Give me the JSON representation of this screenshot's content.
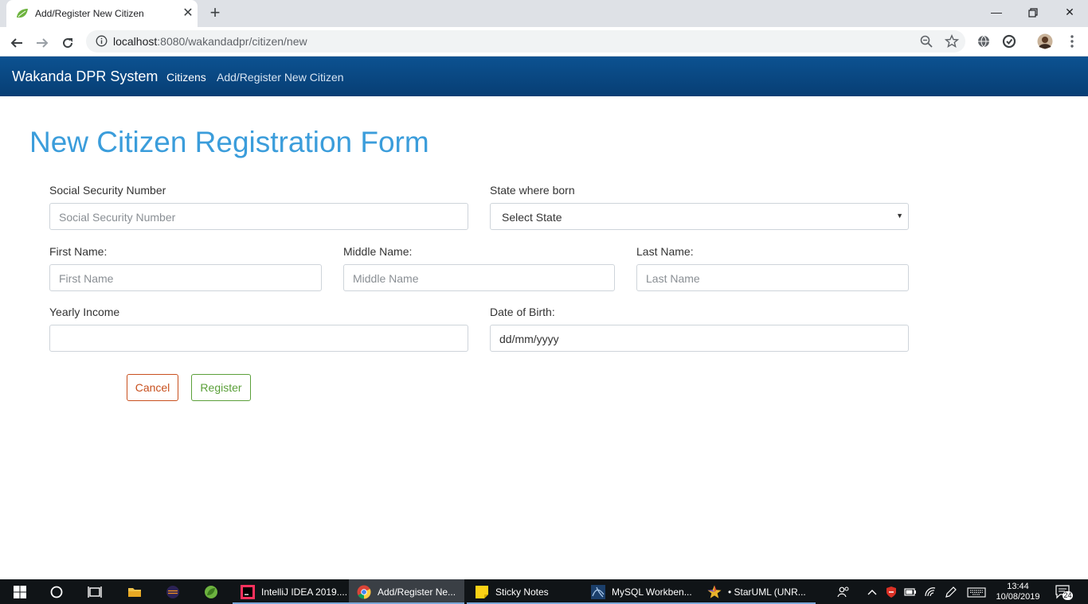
{
  "browser": {
    "tab_title": "Add/Register New Citizen",
    "url_host": "localhost",
    "url_rest": ":8080/wakandadpr/citizen/new"
  },
  "navbar": {
    "brand": "Wakanda DPR System",
    "links": [
      "Citizens",
      "Add/Register New Citizen"
    ]
  },
  "form": {
    "title": "New Citizen Registration Form",
    "ssn": {
      "label": "Social Security Number",
      "placeholder": "Social Security Number"
    },
    "state": {
      "label": "State where born",
      "selected": "Select State"
    },
    "first_name": {
      "label": "First Name:",
      "placeholder": "First Name"
    },
    "middle_name": {
      "label": "Middle Name:",
      "placeholder": "Middle Name"
    },
    "last_name": {
      "label": "Last Name:",
      "placeholder": "Last Name"
    },
    "income": {
      "label": "Yearly Income",
      "value": ""
    },
    "dob": {
      "label": "Date of Birth:",
      "value": "dd/mm/yyyy"
    },
    "cancel_label": "Cancel",
    "register_label": "Register"
  },
  "taskbar": {
    "apps": [
      "IntelliJ IDEA 2019....",
      "Add/Register Ne...",
      "Sticky Notes",
      "MySQL Workben...",
      "• StarUML (UNR..."
    ],
    "time": "13:44",
    "date": "10/08/2019",
    "notification_count": "24"
  },
  "colors": {
    "navbar": "#0a4a86",
    "title": "#3b9ddb",
    "cancel": "#c8501e",
    "register": "#5ba03a"
  },
  "icons": [
    "spring-leaf-icon",
    "close-icon",
    "plus-icon",
    "back-arrow-icon",
    "forward-arrow-icon",
    "reload-icon",
    "info-icon",
    "zoom-icon",
    "star-icon",
    "windows-icon",
    "cortana-icon",
    "task-view-icon",
    "folder-icon",
    "eclipse-icon",
    "spring-tool-icon",
    "intellij-icon",
    "chrome-icon",
    "sticky-notes-icon",
    "mysql-workbench-icon",
    "staruml-icon"
  ]
}
